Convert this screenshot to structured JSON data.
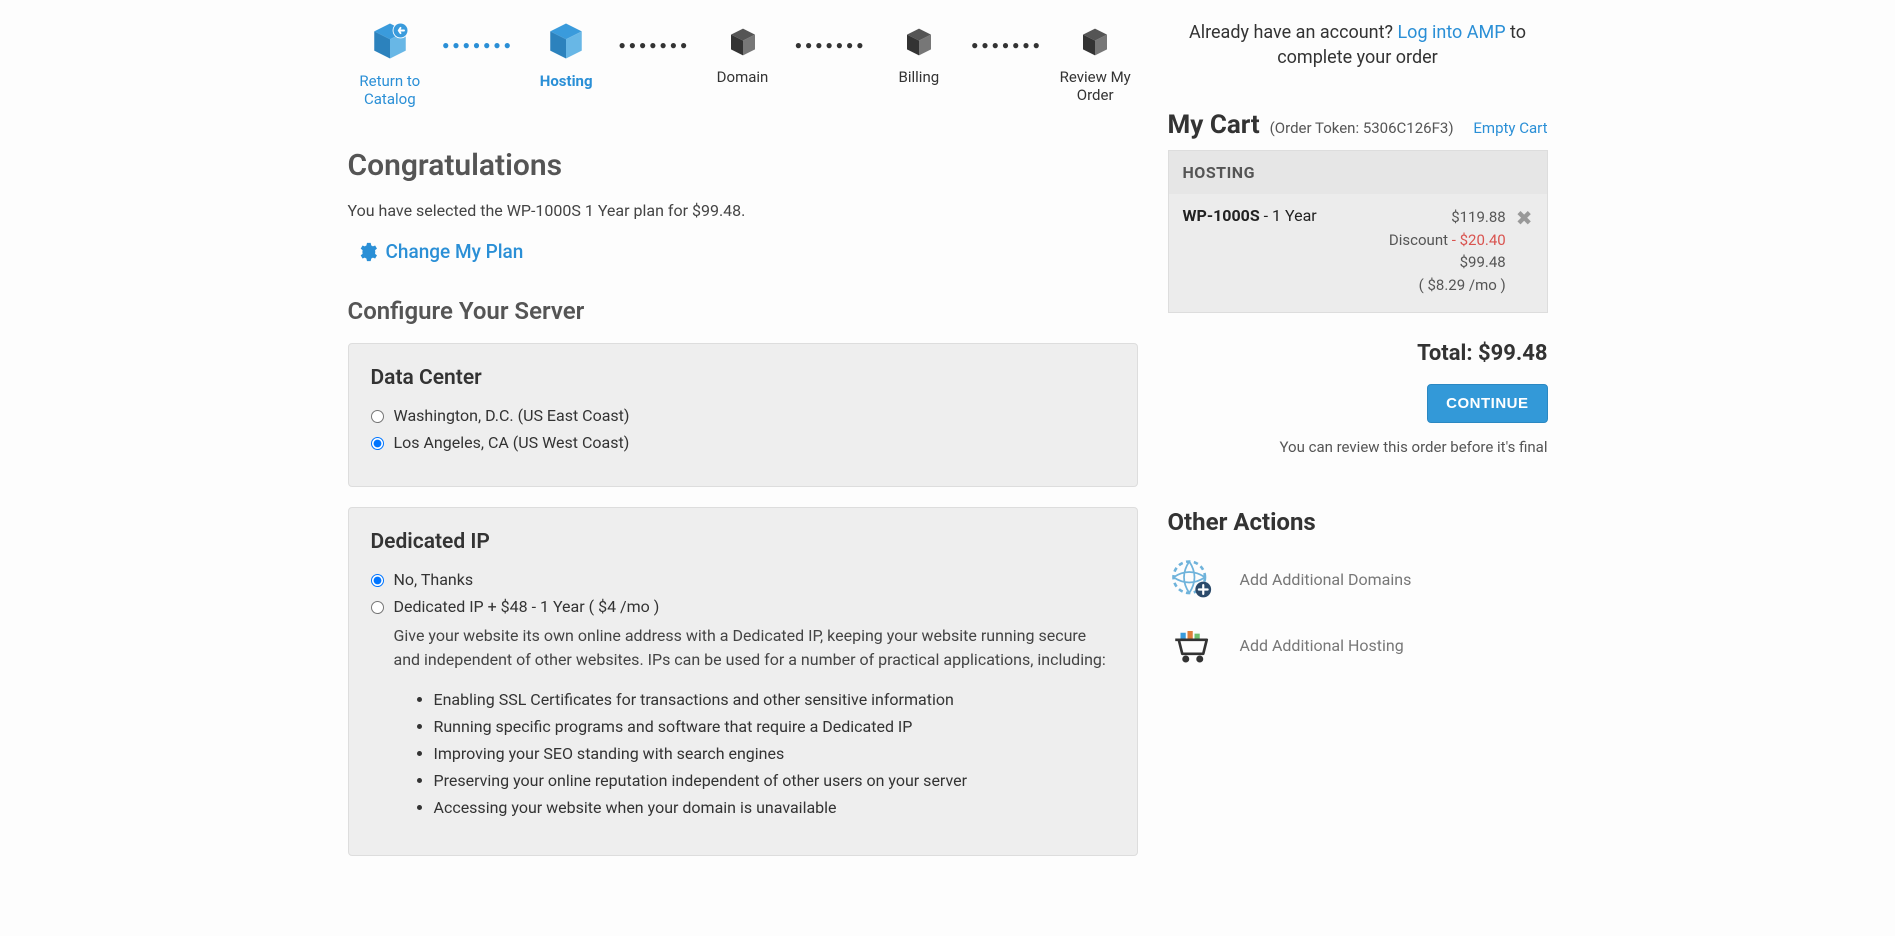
{
  "stepper": {
    "return_to_catalog": "Return to Catalog",
    "hosting": "Hosting",
    "domain": "Domain",
    "billing": "Billing",
    "review": "Review My Order"
  },
  "account_prompt": {
    "prefix": "Already have an account? ",
    "link": "Log into AMP",
    "suffix": " to complete your order"
  },
  "congrats": {
    "heading": "Congratulations",
    "selected_text": "You have selected the WP-1000S 1 Year plan for $99.48.",
    "change_plan": "Change My Plan"
  },
  "configure_heading": "Configure Your Server",
  "datacenter": {
    "heading": "Data Center",
    "options": [
      "Washington, D.C. (US East Coast)",
      "Los Angeles, CA (US West Coast)"
    ],
    "selected_index": 1
  },
  "dedicated_ip": {
    "heading": "Dedicated IP",
    "no_thanks": "No, Thanks",
    "paid_label": "Dedicated IP + $48 - 1 Year ( $4 /mo )",
    "description": "Give your website its own online address with a Dedicated IP, keeping your website running secure and independent of other websites. IPs can be used for a number of practical applications, including:",
    "bullets": [
      "Enabling SSL Certificates for transactions and other sensitive information",
      "Running specific programs and software that require a Dedicated IP",
      "Improving your SEO standing with search engines",
      "Preserving your online reputation independent of other users on your server",
      "Accessing your website when your domain is unavailable"
    ],
    "selected": "no"
  },
  "cart": {
    "title": "My Cart",
    "token_label": "(Order Token: 5306C126F3)",
    "empty_label": "Empty Cart",
    "section_head": "HOSTING",
    "item": {
      "plan": "WP-1000S",
      "term": " - 1 Year",
      "list_price": "$119.88",
      "discount_label": "Discount ",
      "discount_amount": "- $20.40",
      "subtotal": "$99.48",
      "monthly": "( $8.29 /mo )"
    },
    "total_label": "Total: ",
    "total_value": "$99.48",
    "continue": "CONTINUE",
    "review_note": "You can review this order before it's final"
  },
  "other_actions": {
    "heading": "Other Actions",
    "add_domains": "Add Additional Domains",
    "add_hosting": "Add Additional Hosting"
  }
}
